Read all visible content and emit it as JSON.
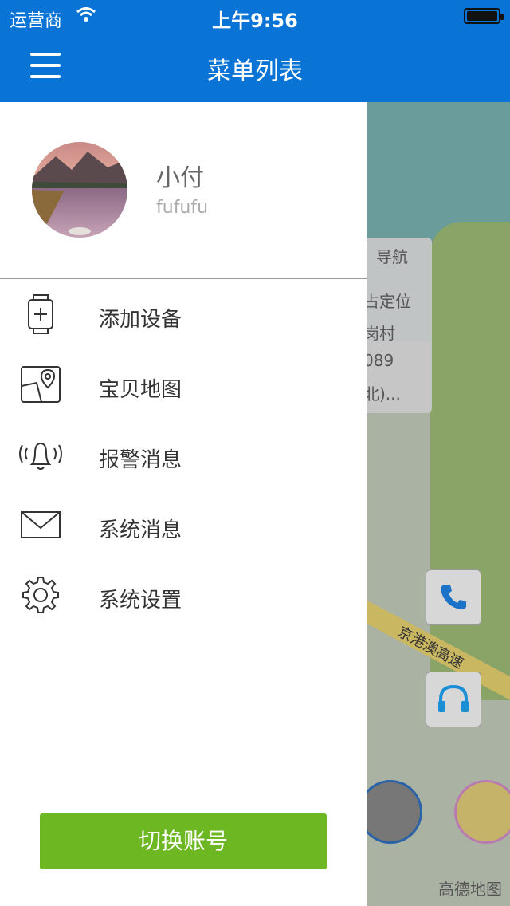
{
  "status_bar": {
    "carrier": "运营商",
    "time": "上午9:56"
  },
  "nav": {
    "title": "菜单列表",
    "menu_icon": "hamburger-menu-icon"
  },
  "profile": {
    "name": "小付",
    "account": "fufufu"
  },
  "menu": {
    "items": [
      {
        "label": "添加设备",
        "icon": "add-device-icon"
      },
      {
        "label": "宝贝地图",
        "icon": "map-pin-icon"
      },
      {
        "label": "报警消息",
        "icon": "alarm-bell-icon"
      },
      {
        "label": "系统消息",
        "icon": "mail-icon"
      },
      {
        "label": "系统设置",
        "icon": "gear-icon"
      }
    ]
  },
  "switch_account_label": "切换账号",
  "map": {
    "nav_label": "导航",
    "popup_lines": [
      "占定位",
      "岗村",
      "089",
      "北)..."
    ],
    "road_label": "京港澳高速",
    "logo": "高德地图"
  },
  "colors": {
    "primary": "#0a74d6",
    "accent_green": "#6db722"
  }
}
